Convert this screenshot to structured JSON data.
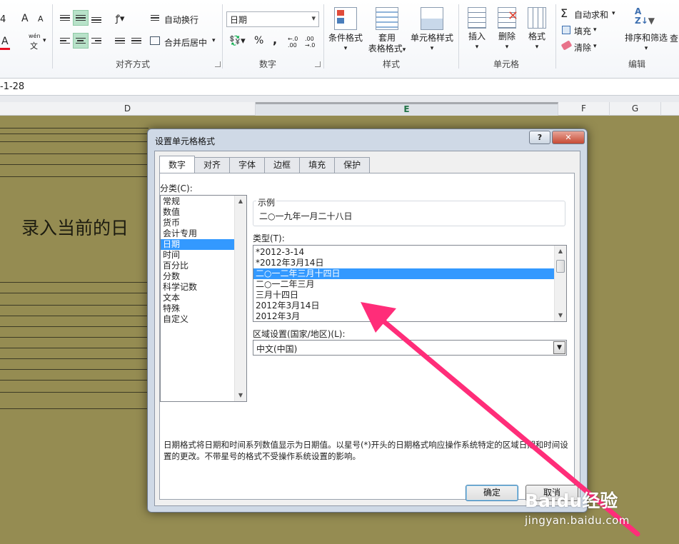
{
  "ribbon": {
    "font_size_fragment": "4",
    "grow_font": "A",
    "shrink_font": "A",
    "font_color_letter": "A",
    "phonetic_top": "wén",
    "phonetic_bottom": "文",
    "wrap_text": "自动换行",
    "merge_center": "合并后居中",
    "align_group": "对齐方式",
    "number_format_value": "日期",
    "percent": "%",
    "comma": ",",
    "inc_decimal": "←.0 .00",
    "dec_decimal": ".00 →.0",
    "number_group": "数字",
    "conditional_format": "条件格式",
    "format_as_table_1": "套用",
    "format_as_table_2": "表格格式",
    "cell_styles": "单元格样式",
    "styles_group": "样式",
    "insert": "插入",
    "delete": "删除",
    "format": "格式",
    "cells_group": "单元格",
    "autosum": "自动求和",
    "fill": "填充",
    "clear": "清除",
    "sort_filter": "排序和筛选",
    "find_select_fragment": "查",
    "editing_group": "编辑"
  },
  "formula_bar": {
    "value": "-1-28"
  },
  "columns": {
    "d": "D",
    "e": "E",
    "f": "F",
    "g": "G"
  },
  "sheet": {
    "big_text": "录入当前的日"
  },
  "dialog": {
    "title": "设置单元格格式",
    "help_btn": "?",
    "close_btn": "✕",
    "tabs": [
      "数字",
      "对齐",
      "字体",
      "边框",
      "填充",
      "保护"
    ],
    "category_label": "分类(C):",
    "categories": [
      "常规",
      "数值",
      "货币",
      "会计专用",
      "日期",
      "时间",
      "百分比",
      "分数",
      "科学记数",
      "文本",
      "特殊",
      "自定义"
    ],
    "selected_category": "日期",
    "sample_label": "示例",
    "sample_value": "二○一九年一月二十八日",
    "type_label": "类型(T):",
    "types": [
      "*2012-3-14",
      "*2012年3月14日",
      "二○一二年三月十四日",
      "二○一二年三月",
      "三月十四日",
      "2012年3月14日",
      "2012年3月"
    ],
    "selected_type": "二○一二年三月十四日",
    "locale_label": "区域设置(国家/地区)(L):",
    "locale_value": "中文(中国)",
    "description": "日期格式将日期和时间系列数值显示为日期值。以星号(*)开头的日期格式响应操作系统特定的区域日期和时间设置的更改。不带星号的格式不受操作系统设置的影响。",
    "ok": "确定",
    "cancel": "取消"
  },
  "watermark": {
    "brand": "Baidu经验",
    "url": "jingyan.baidu.com"
  },
  "colors": {
    "accent_select": "#3399ff",
    "arrow": "#ff2d79",
    "dim_sheet": "#958c52"
  }
}
